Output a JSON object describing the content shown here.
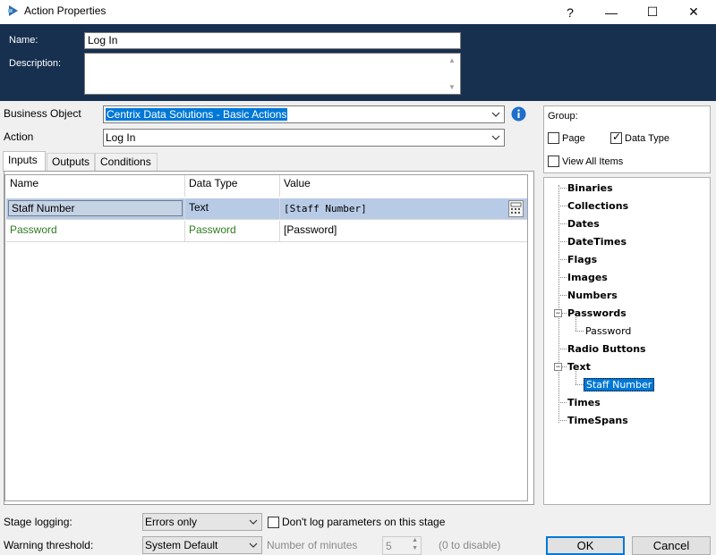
{
  "window": {
    "title": "Action Properties",
    "help": "?",
    "minimize": "—",
    "maximize": "☐",
    "close": "✕"
  },
  "header": {
    "name_label": "Name:",
    "name_value": "Log In",
    "description_label": "Description:",
    "description_value": ""
  },
  "business_object": {
    "label": "Business Object",
    "value": "Centrix Data Solutions - Basic Actions"
  },
  "action": {
    "label": "Action",
    "value": "Log In"
  },
  "tabs": [
    {
      "label": "Inputs"
    },
    {
      "label": "Outputs"
    },
    {
      "label": "Conditions"
    }
  ],
  "grid": {
    "headers": [
      "Name",
      "Data Type",
      "Value"
    ],
    "rows": [
      {
        "name": "Staff Number",
        "type": "Text",
        "value": "[Staff Number]"
      },
      {
        "name": "Password",
        "type": "Password",
        "value": "[Password]"
      }
    ]
  },
  "group": {
    "label": "Group:",
    "page_label": "Page",
    "page_checked": false,
    "datatype_label": "Data Type",
    "datatype_checked": true,
    "viewall_label": "View All Items",
    "viewall_checked": false
  },
  "tree": {
    "items": [
      "Binaries",
      "Collections",
      "Dates",
      "DateTimes",
      "Flags",
      "Images",
      "Numbers",
      "Passwords",
      "Radio Buttons",
      "Text",
      "Times",
      "TimeSpans"
    ],
    "password_child": "Password",
    "text_child": "Staff Number"
  },
  "bottom": {
    "stage_logging_label": "Stage logging:",
    "stage_logging_value": "Errors only",
    "dont_log_label": "Don't log parameters on this stage",
    "warning_label": "Warning threshold:",
    "warning_value": "System Default",
    "minutes_label": "Number of minutes",
    "minutes_value": "5",
    "disable_hint": "(0 to disable)",
    "ok": "OK",
    "cancel": "Cancel"
  }
}
